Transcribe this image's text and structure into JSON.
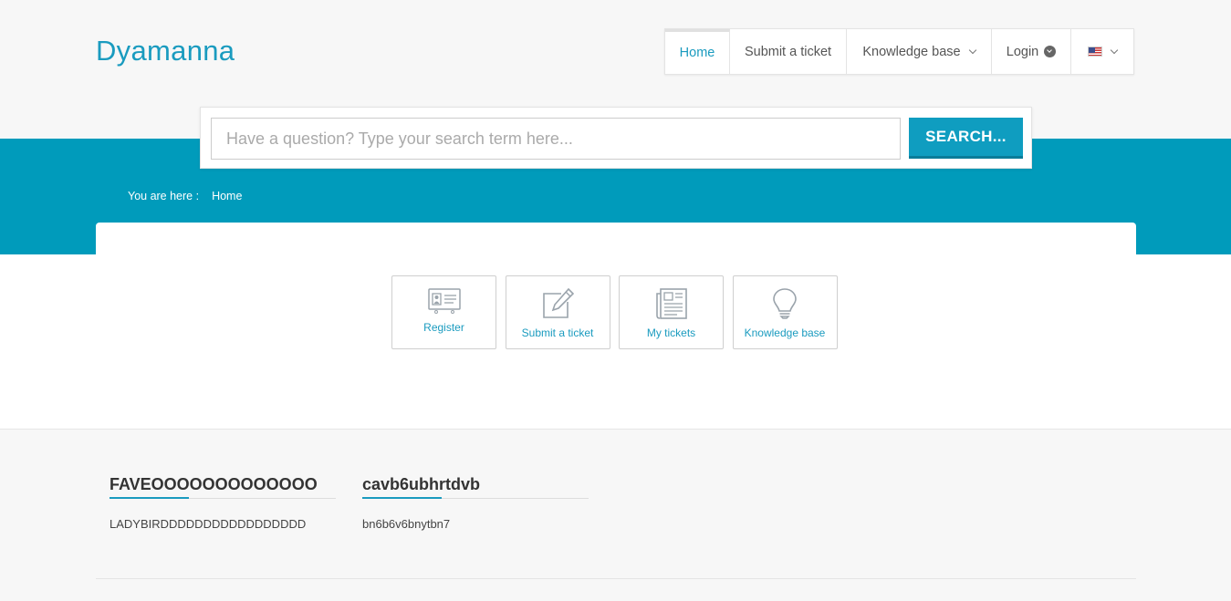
{
  "header": {
    "logo": "Dyamanna",
    "nav": {
      "home": "Home",
      "submit_ticket": "Submit a ticket",
      "knowledge_base": "Knowledge base",
      "login": "Login"
    }
  },
  "search": {
    "placeholder": "Have a question? Type your search term here...",
    "button": "SEARCH..."
  },
  "breadcrumb": {
    "prefix": "You are here :",
    "current": "Home"
  },
  "tiles": [
    {
      "label": "Register",
      "icon": "id-card-icon"
    },
    {
      "label": "Submit a ticket",
      "icon": "edit-icon"
    },
    {
      "label": "My tickets",
      "icon": "newspaper-icon"
    },
    {
      "label": "Knowledge base",
      "icon": "lightbulb-icon"
    }
  ],
  "sections": [
    {
      "title": "FAVEOOOOOOOOOOOOO",
      "text": "LADYBIRDDDDDDDDDDDDDDDDD"
    },
    {
      "title": "cavb6ubhrtdvb",
      "text": "bn6b6v6bnytbn7"
    }
  ],
  "colors": {
    "accent": "#1a9bbf",
    "band": "#009bbb",
    "search_button": "#0f9dc0"
  }
}
